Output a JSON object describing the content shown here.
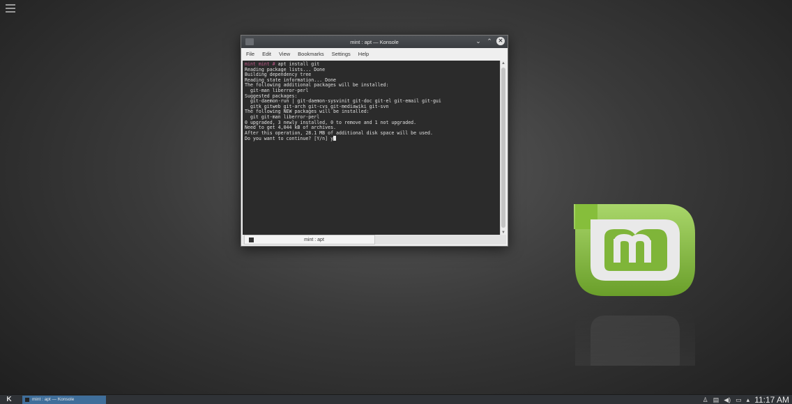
{
  "window": {
    "title": "mint : apt — Konsole",
    "menu": [
      "File",
      "Edit",
      "View",
      "Bookmarks",
      "Settings",
      "Help"
    ],
    "controls": {
      "minimize": "⌄",
      "maximize": "⌃",
      "close": "✕"
    }
  },
  "terminal": {
    "prompt": "mint mint #",
    "command": " apt install git",
    "lines": [
      "Reading package lists... Done",
      "Building dependency tree",
      "Reading state information... Done",
      "The following additional packages will be installed:",
      "  git-man liberror-perl",
      "Suggested packages:",
      "  git-daemon-run | git-daemon-sysvinit git-doc git-el git-email git-gui",
      "  gitk gitweb git-arch git-cvs git-mediawiki git-svn",
      "The following NEW packages will be installed:",
      "  git git-man liberror-perl",
      "0 upgraded, 3 newly installed, 0 to remove and 1 not upgraded.",
      "Need to get 4,044 kB of archives.",
      "After this operation, 28.1 MB of additional disk space will be used."
    ],
    "last_line": "Do you want to continue? [Y/n] y"
  },
  "tab": {
    "label": "mint : apt"
  },
  "taskbar": {
    "start": "K",
    "task_label": "mint : apt — Konsole",
    "tray_icons": [
      "user-icon",
      "clipboard-icon",
      "volume-icon",
      "display-icon",
      "expand-arrow-icon"
    ],
    "clock": "11:17 AM"
  },
  "colors": {
    "accent": "#3f6e9a",
    "logo_green": "#86be3b",
    "prompt": "#c05a8a"
  }
}
